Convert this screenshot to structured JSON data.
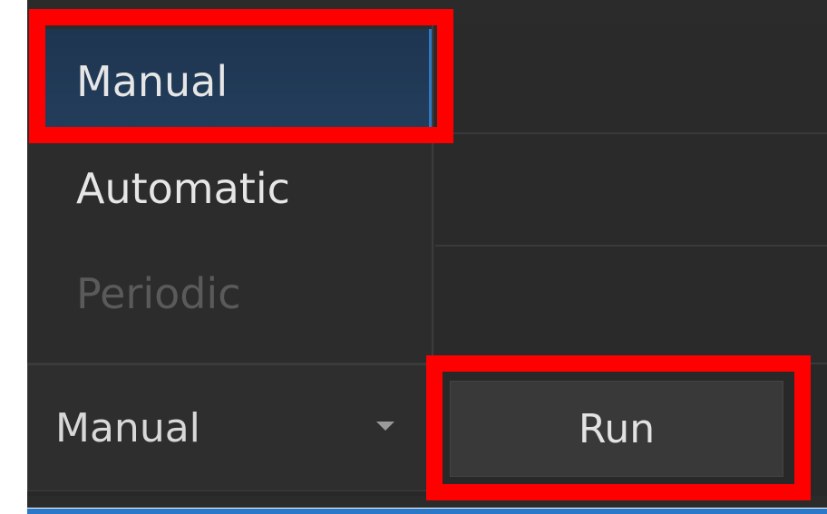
{
  "dropdown": {
    "items": [
      {
        "label": "Manual",
        "state": "selected"
      },
      {
        "label": "Automatic",
        "state": "normal"
      },
      {
        "label": "Periodic",
        "state": "disabled"
      }
    ]
  },
  "select": {
    "value": "Manual",
    "arrow_icon": "caret-down-icon"
  },
  "run_button": {
    "label": "Run"
  },
  "colors": {
    "highlight": "#ff0000",
    "selected_bg": "#233e5c",
    "panel_bg": "#2b2b2b",
    "accent_strip": "#2a78c7"
  }
}
